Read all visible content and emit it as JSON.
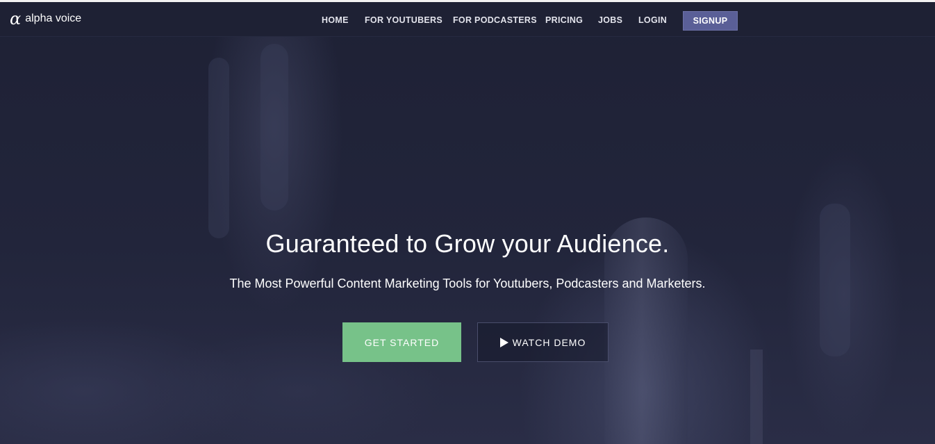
{
  "brand": {
    "logo_symbol": "α",
    "name": "alpha voice"
  },
  "nav": {
    "items": [
      {
        "label": "HOME"
      },
      {
        "label": "FOR YOUTUBERS"
      },
      {
        "label": "FOR PODCASTERS"
      },
      {
        "label": "PRICING"
      },
      {
        "label": "JOBS"
      },
      {
        "label": "LOGIN"
      }
    ],
    "signup_label": "SIGNUP"
  },
  "hero": {
    "headline": "Guaranteed to Grow your Audience.",
    "subhead": "The Most Powerful Content Marketing Tools for Youtubers, Podcasters and Marketers.",
    "primary_cta": "GET STARTED",
    "secondary_cta": "WATCH DEMO"
  },
  "colors": {
    "background": "#1f2238",
    "navbar": "#1e2134",
    "signup": "#5a5f97",
    "get_started": "#77c289"
  },
  "icons": {
    "play": "play-icon"
  }
}
